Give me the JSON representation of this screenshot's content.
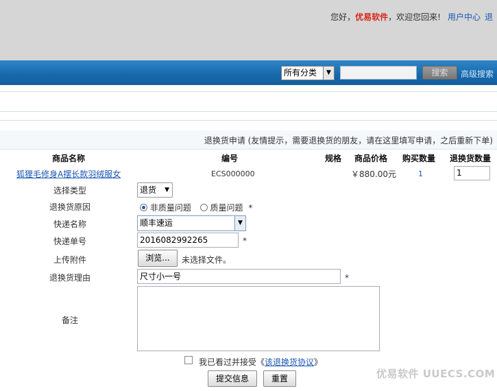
{
  "header": {
    "greeting_prefix": "您好，",
    "brand": "优易软件",
    "greeting_suffix": "，欢迎您回来!",
    "user_center": "用户中心",
    "cut_link": "退"
  },
  "search": {
    "category": "所有分类",
    "query": "",
    "button": "搜索",
    "advanced": "高级搜索"
  },
  "notice": "退换货申请 (友情提示，需要退换货的朋友，请在这里填写申请，之后重新下单)",
  "table": {
    "headers": [
      "商品名称",
      "编号",
      "规格",
      "商品价格",
      "购买数量",
      "退换货数量"
    ],
    "row": {
      "name": "狐狸毛修身A摆长款羽绒服女",
      "code": "ECS000000",
      "spec": "",
      "price": "￥880.00元",
      "qty": "1",
      "return_qty": "1"
    }
  },
  "form": {
    "type_label": "选择类型",
    "type_value": "退货",
    "reason_label": "退换货原因",
    "reason_option1": "非质量问题",
    "reason_option2": "质量问题",
    "courier_label": "快递名称",
    "courier_value": "顺丰速运",
    "tracking_label": "快递单号",
    "tracking_value": "2016082992265",
    "upload_label": "上传附件",
    "browse_button": "浏览...",
    "no_file": "未选择文件。",
    "return_reason_label": "退换货理由",
    "return_reason_value": "尺寸小一号",
    "note_label": "备注",
    "note_value": "",
    "required_mark": "*",
    "agree_text": "我已看过并接受《",
    "agree_link": "该退换货协议",
    "agree_end": "》",
    "submit": "提交信息",
    "reset": "重置"
  },
  "watermark": "优易软件 UUECS.COM"
}
